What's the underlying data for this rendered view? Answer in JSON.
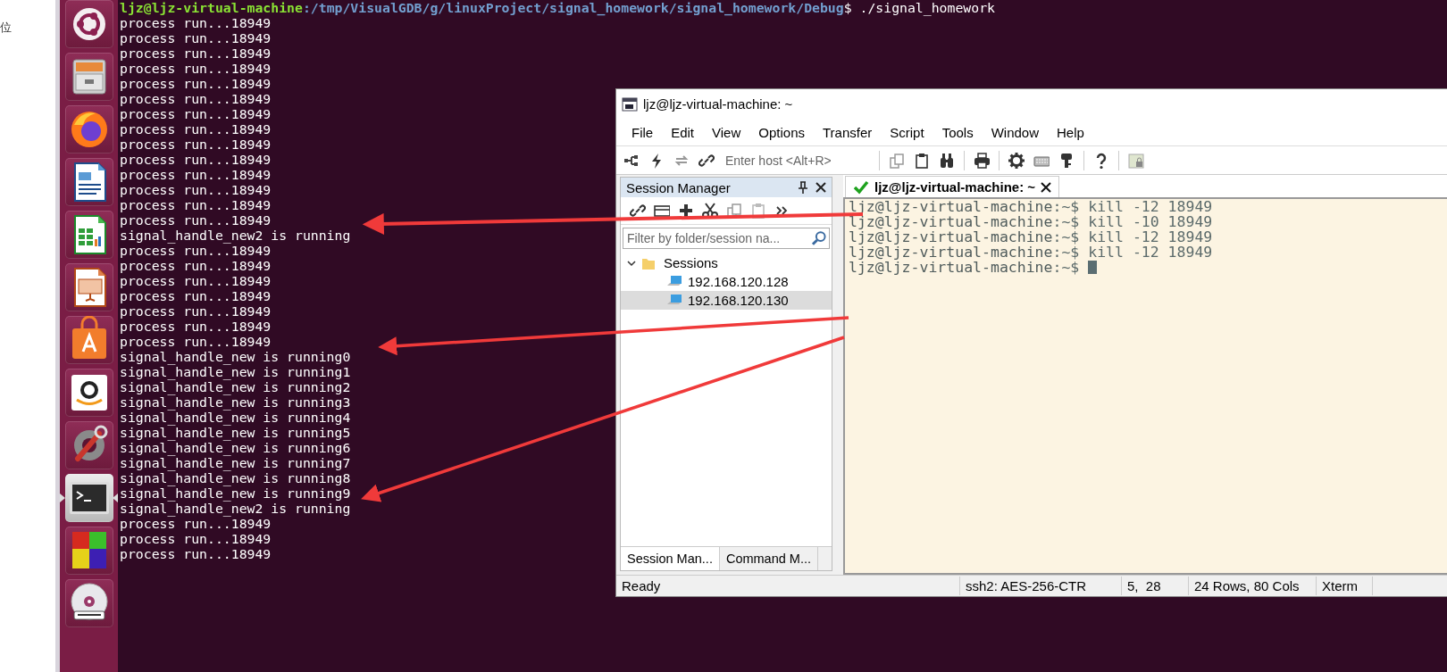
{
  "desktop_edge": {
    "text": "位"
  },
  "launcher": {
    "items": [
      {
        "kind": "ubuntu",
        "selected": false
      },
      {
        "kind": "files",
        "selected": false
      },
      {
        "kind": "firefox",
        "selected": false
      },
      {
        "kind": "writer",
        "selected": false
      },
      {
        "kind": "calc",
        "selected": false
      },
      {
        "kind": "impress",
        "selected": false
      },
      {
        "kind": "software",
        "selected": false
      },
      {
        "kind": "amazon",
        "selected": false
      },
      {
        "kind": "settings",
        "selected": false
      },
      {
        "kind": "terminal",
        "selected": true
      },
      {
        "kind": "cubes",
        "selected": false
      },
      {
        "kind": "dvd",
        "selected": false
      }
    ]
  },
  "terminal": {
    "command_line": {
      "user": "ljz@ljz-virtual-machine",
      "path": ":/tmp/VisualGDB/g/linuxProject/signal_homework/signal_homework/Debug",
      "command": "$ ./signal_homework"
    },
    "lines": [
      "process run...18949",
      "process run...18949",
      "process run...18949",
      "process run...18949",
      "process run...18949",
      "process run...18949",
      "process run...18949",
      "process run...18949",
      "process run...18949",
      "process run...18949",
      "process run...18949",
      "process run...18949",
      "process run...18949",
      "process run...18949",
      "signal_handle_new2 is running",
      "process run...18949",
      "process run...18949",
      "process run...18949",
      "process run...18949",
      "process run...18949",
      "process run...18949",
      "process run...18949",
      "signal_handle_new is running0",
      "signal_handle_new is running1",
      "signal_handle_new is running2",
      "signal_handle_new is running3",
      "signal_handle_new is running4",
      "signal_handle_new is running5",
      "signal_handle_new is running6",
      "signal_handle_new is running7",
      "signal_handle_new is running8",
      "signal_handle_new is running9",
      "signal_handle_new2 is running",
      "process run...18949",
      "process run...18949",
      "process run...18949"
    ]
  },
  "securecrt": {
    "title": "ljz@ljz-virtual-machine: ~",
    "menu": [
      "File",
      "Edit",
      "View",
      "Options",
      "Transfer",
      "Script",
      "Tools",
      "Window",
      "Help"
    ],
    "toolbar": {
      "host_placeholder": "Enter host <Alt+R>"
    },
    "session_manager": {
      "title": "Session Manager",
      "filter_placeholder": "Filter by folder/session na...",
      "tree": [
        {
          "label": "Sessions",
          "expanded": true,
          "children": [
            {
              "label": "192.168.120.128",
              "selected": false
            },
            {
              "label": "192.168.120.130",
              "selected": true
            }
          ]
        }
      ],
      "bottom_tabs": [
        {
          "label": "Session Man...",
          "selected": true
        },
        {
          "label": "Command M...",
          "selected": false
        }
      ]
    },
    "session_tab": {
      "label": "ljz@ljz-virtual-machine: ~",
      "connected": true
    },
    "console": [
      {
        "prompt": "ljz@ljz-virtual-machine",
        "rest": ":~$ kill -12 18949"
      },
      {
        "prompt": "ljz@ljz-virtual-machine",
        "rest": ":~$ kill -10 18949"
      },
      {
        "prompt": "ljz@ljz-virtual-machine",
        "rest": ":~$ kill -12 18949"
      },
      {
        "prompt": "ljz@ljz-virtual-machine",
        "rest": ":~$ kill -12 18949"
      },
      {
        "prompt": "ljz@ljz-virtual-machine",
        "rest": ":~$ ",
        "cursor": true
      }
    ],
    "status_bar": [
      "Ready",
      "ssh2: AES-256-CTR",
      "5,  28",
      "24 Rows, 80 Cols",
      "Xterm"
    ]
  }
}
